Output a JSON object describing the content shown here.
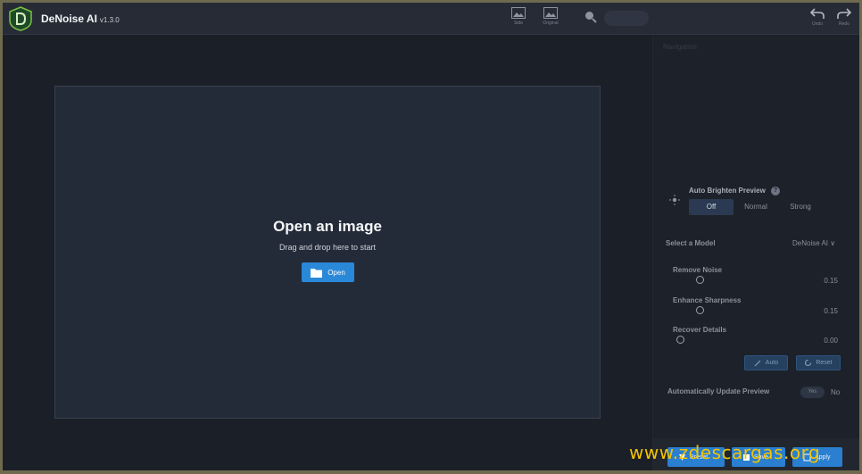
{
  "app": {
    "name": "DeNoise AI",
    "version": "v1.3.0"
  },
  "toolbar": {
    "side_label": "Side",
    "original_label": "Original",
    "zoom_value": "",
    "undo_label": "Undo",
    "redo_label": "Redo"
  },
  "canvas": {
    "title": "Open an image",
    "subtitle": "Drag and drop here to start",
    "open_label": "Open"
  },
  "panel": {
    "section_title": "Navigation",
    "auto_brighten": {
      "label": "Auto Brighten Preview",
      "options": [
        "Off",
        "Normal",
        "Strong"
      ],
      "selected": "Off"
    },
    "model": {
      "label": "Select a Model",
      "value": "DeNoise AI ∨"
    },
    "sliders": [
      {
        "label": "Remove Noise",
        "value": "0.15",
        "fraction": 0.15
      },
      {
        "label": "Enhance Sharpness",
        "value": "0.15",
        "fraction": 0.15
      },
      {
        "label": "Recover Details",
        "value": "0.00",
        "fraction": 0.0
      }
    ],
    "auto_button": "Auto",
    "reset_button": "Reset",
    "auto_update": {
      "label": "Automatically Update Preview",
      "yes": "Yes",
      "no": "No"
    },
    "bottom": {
      "preset_label": "Preset",
      "save_label": "Save",
      "apply_label": "Apply"
    }
  },
  "watermark": "www.zdescargas.org",
  "colors": {
    "accent": "#2a88d8",
    "background": "#1b1f27",
    "panel": "#1d2129",
    "watermark": "#f2c300"
  }
}
